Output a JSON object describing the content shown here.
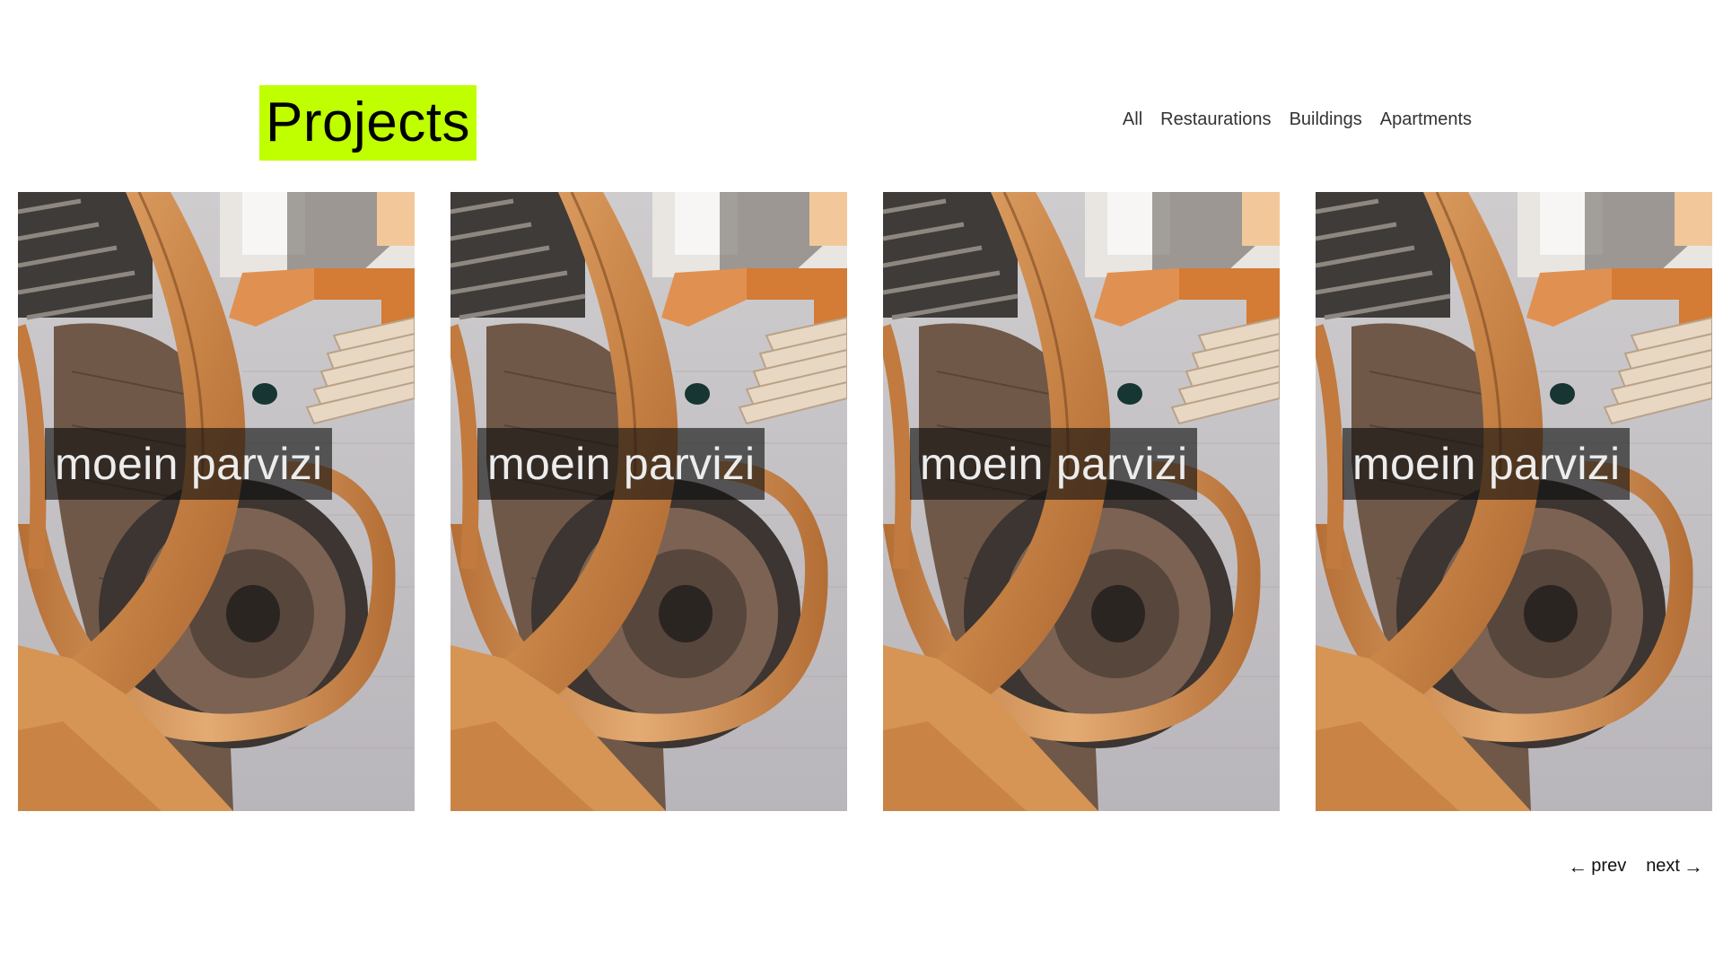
{
  "header": {
    "title": "Projects",
    "title_highlight_color": "#bfff00"
  },
  "nav": {
    "items": [
      {
        "label": "All"
      },
      {
        "label": "Restaurations"
      },
      {
        "label": "Buildings"
      },
      {
        "label": "Apartments"
      }
    ]
  },
  "gallery": {
    "image_subject": "spiral wooden staircase",
    "cards": [
      {
        "caption": "moein parvizi"
      },
      {
        "caption": "moein parvizi"
      },
      {
        "caption": "moein parvizi"
      },
      {
        "caption": "moein parvizi"
      }
    ]
  },
  "pager": {
    "prev_label": "prev",
    "prev_icon": "arrow-left-icon",
    "next_label": "next",
    "next_icon": "arrow-right-icon"
  }
}
